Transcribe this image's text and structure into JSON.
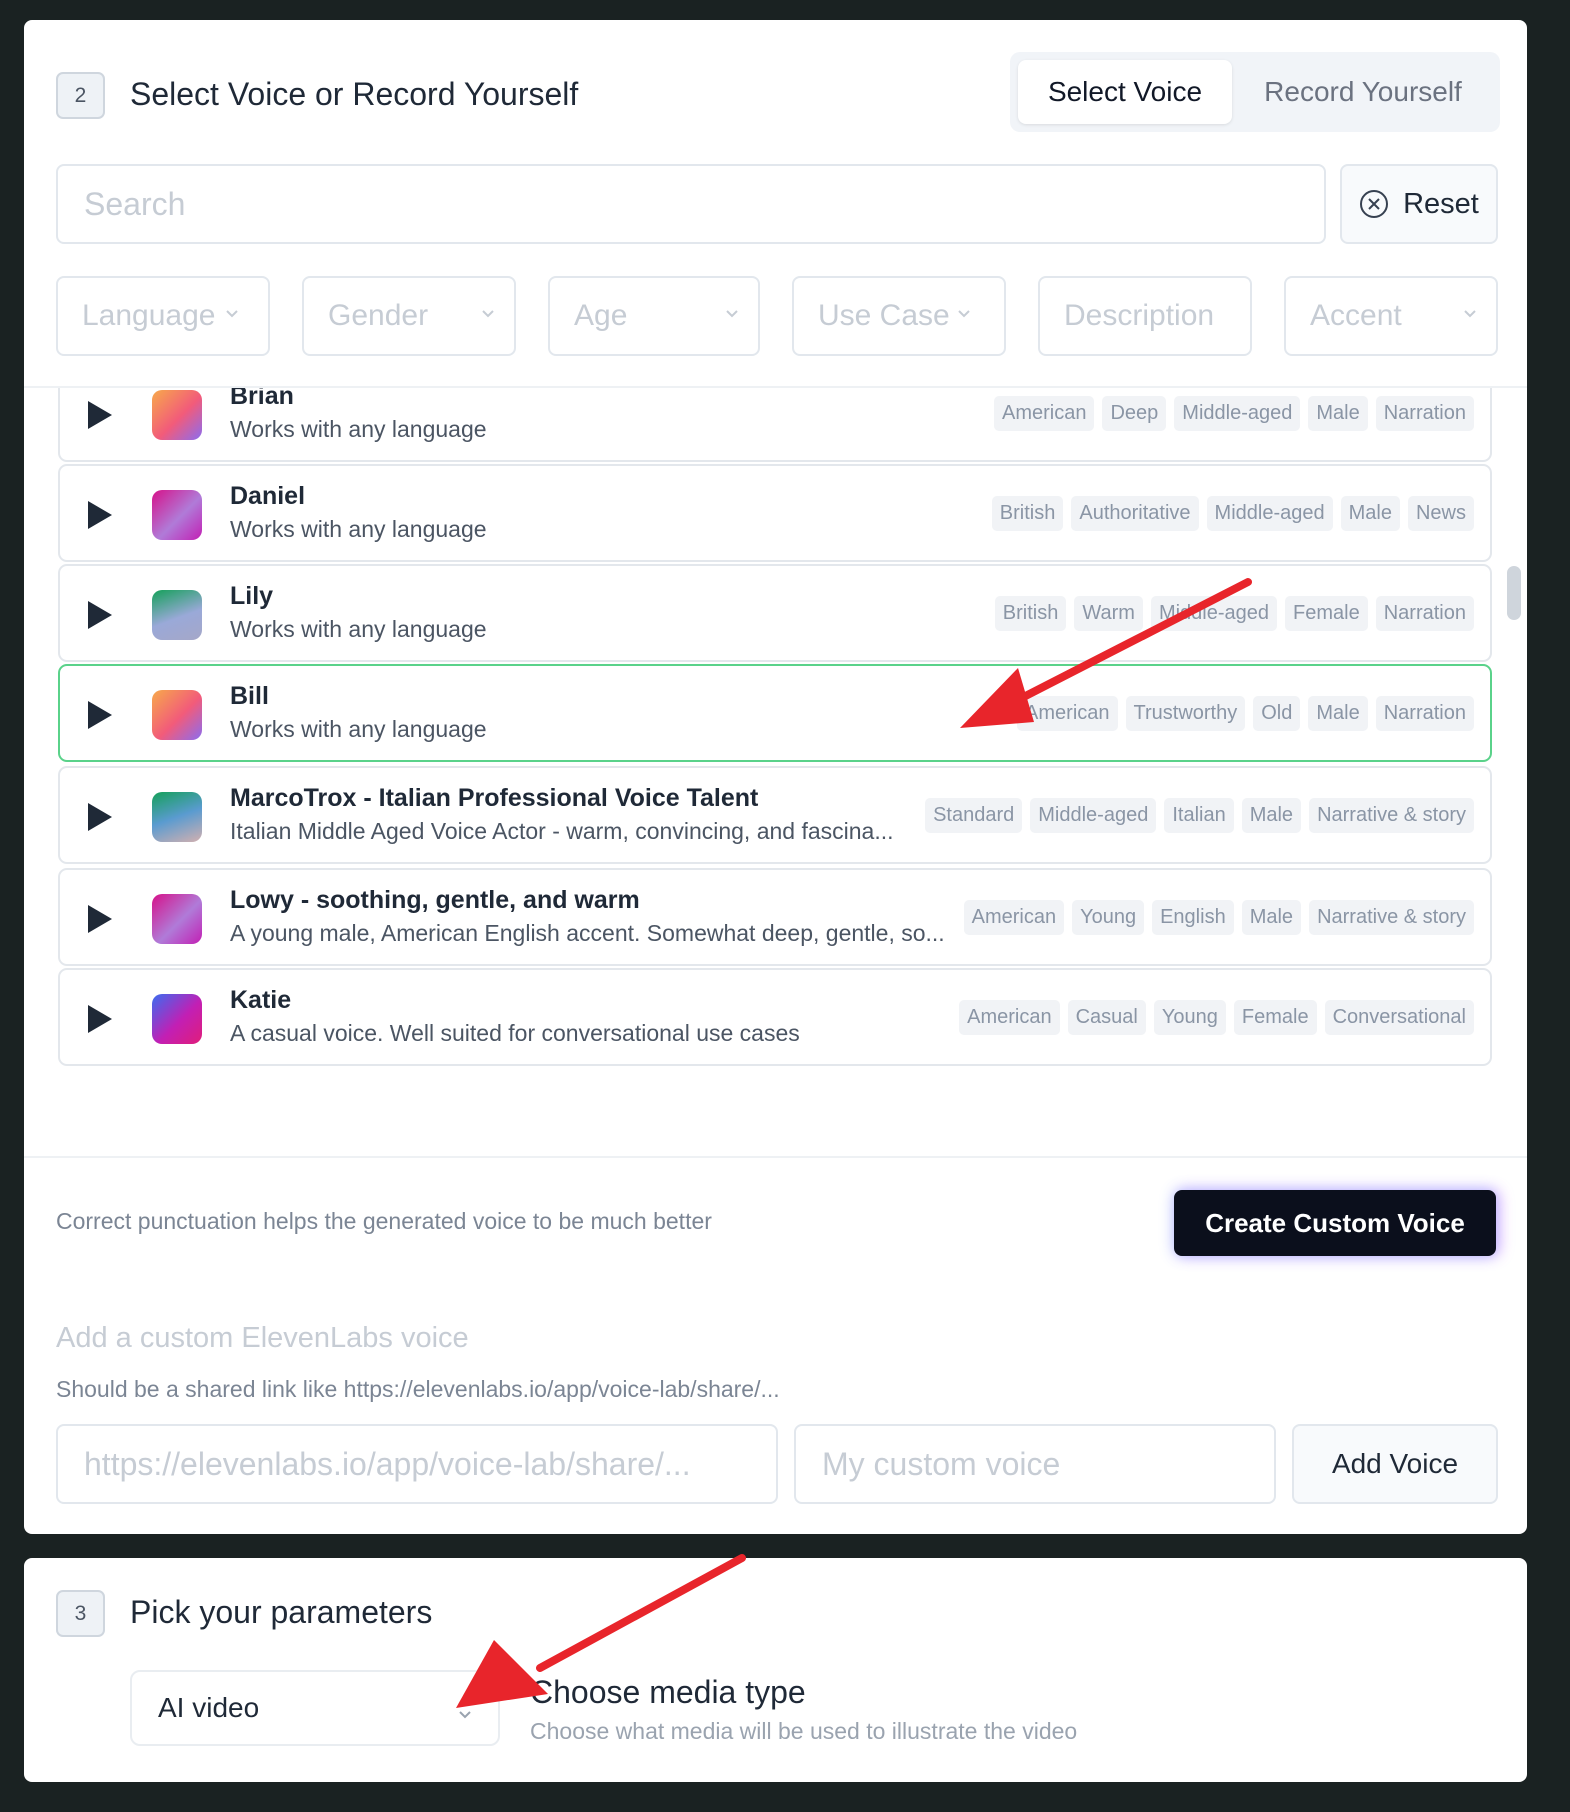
{
  "step2": {
    "number": "2",
    "title": "Select Voice or Record Yourself",
    "tabs": [
      "Select Voice",
      "Record Yourself"
    ],
    "search_placeholder": "Search",
    "reset_label": "Reset",
    "filters": [
      "Language",
      "Gender",
      "Age",
      "Use Case",
      "Description",
      "Accent"
    ],
    "voices": [
      {
        "name": "Brian",
        "desc": "Works with any language",
        "tags": [
          "American",
          "Deep",
          "Middle-aged",
          "Male",
          "Narration"
        ]
      },
      {
        "name": "Daniel",
        "desc": "Works with any language",
        "tags": [
          "British",
          "Authoritative",
          "Middle-aged",
          "Male",
          "News"
        ]
      },
      {
        "name": "Lily",
        "desc": "Works with any language",
        "tags": [
          "British",
          "Warm",
          "Middle-aged",
          "Female",
          "Narration"
        ]
      },
      {
        "name": "Bill",
        "desc": "Works with any language",
        "tags": [
          "American",
          "Trustworthy",
          "Old",
          "Male",
          "Narration"
        ]
      },
      {
        "name": "MarcoTrox - Italian Professional Voice Talent",
        "desc": "Italian Middle Aged Voice Actor - warm, convincing, and fascina...",
        "tags": [
          "Standard",
          "Middle-aged",
          "Italian",
          "Male",
          "Narrative & story"
        ]
      },
      {
        "name": "Lowy - soothing, gentle, and warm",
        "desc": "A young male, American English accent. Somewhat deep, gentle, so...",
        "tags": [
          "American",
          "Young",
          "English",
          "Male",
          "Narrative & story"
        ]
      },
      {
        "name": "Katie",
        "desc": "A casual voice. Well suited for conversational use cases",
        "tags": [
          "American",
          "Casual",
          "Young",
          "Female",
          "Conversational"
        ]
      }
    ],
    "punctuation_hint": "Correct punctuation helps the generated voice to be much better",
    "create_custom_voice": "Create Custom Voice",
    "custom_heading": "Add a custom ElevenLabs voice",
    "custom_hint": "Should be a shared link like https://elevenlabs.io/app/voice-lab/share/...",
    "url_placeholder": "https://elevenlabs.io/app/voice-lab/share/...",
    "name_placeholder": "My custom voice",
    "add_voice": "Add Voice"
  },
  "step3": {
    "number": "3",
    "title": "Pick your parameters",
    "media_select_value": "AI video",
    "media_title": "Choose media type",
    "media_sub": "Choose what media will be used to illustrate the video"
  },
  "colors": {
    "page_bg": "#1a2222",
    "selected_border": "#5ad28a",
    "annotation_arrow": "#e8252b",
    "create_button_bg": "#0b0f1c"
  }
}
